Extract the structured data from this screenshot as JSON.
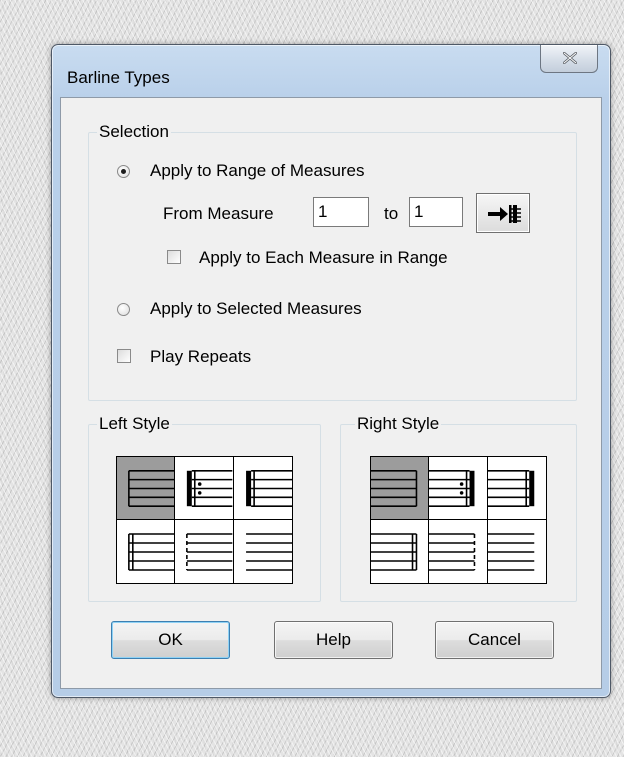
{
  "window": {
    "title": "Barline Types",
    "close_icon": "close-x-icon"
  },
  "selection": {
    "group_label": "Selection",
    "range_option": {
      "label": "Apply to Range of Measures",
      "checked": true
    },
    "from_label": "From Measure",
    "from_value": "1",
    "to_label": "to",
    "to_value": "1",
    "goto_icon": "go-to-end-icon",
    "each_measure": {
      "label": "Apply to Each Measure in Range",
      "checked": false
    },
    "selected_option": {
      "label": "Apply to Selected Measures",
      "checked": false
    },
    "play_repeats": {
      "label": "Play Repeats",
      "checked": false
    }
  },
  "left_style": {
    "label": "Left Style",
    "selected_index": 0,
    "options": [
      "normal",
      "repeat-start",
      "heavy-start",
      "double-thin",
      "dashed",
      "invisible"
    ]
  },
  "right_style": {
    "label": "Right Style",
    "selected_index": 0,
    "options": [
      "normal",
      "repeat-end",
      "final",
      "double-thin",
      "dashed",
      "invisible"
    ]
  },
  "buttons": {
    "ok": "OK",
    "help": "Help",
    "cancel": "Cancel"
  }
}
